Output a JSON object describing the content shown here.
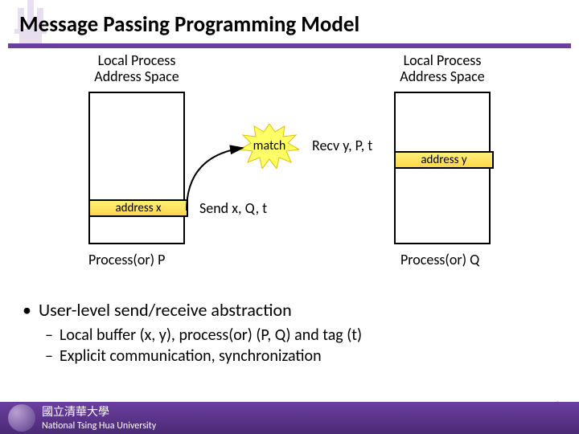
{
  "title": "Message Passing Programming Model",
  "diagram": {
    "left_label_line1": "Local Process",
    "left_label_line2": "Address Space",
    "right_label_line1": "Local Process",
    "right_label_line2": "Address Space",
    "left_slot": "address x",
    "right_slot": "address y",
    "left_proc": "Process(or) P",
    "right_proc": "Process(or) Q",
    "starburst_text": "match",
    "recv_text": "Recv y, P, t",
    "send_text": "Send x, Q, t"
  },
  "bullets": {
    "lvl1": "User-level send/receive abstraction",
    "lvl2a": "Local buffer (x, y), process(or) (P, Q) and tag (t)",
    "lvl2b": "Explicit communication, synchronization"
  },
  "footer": {
    "university": "National Tsing Hua University",
    "page": "6"
  }
}
